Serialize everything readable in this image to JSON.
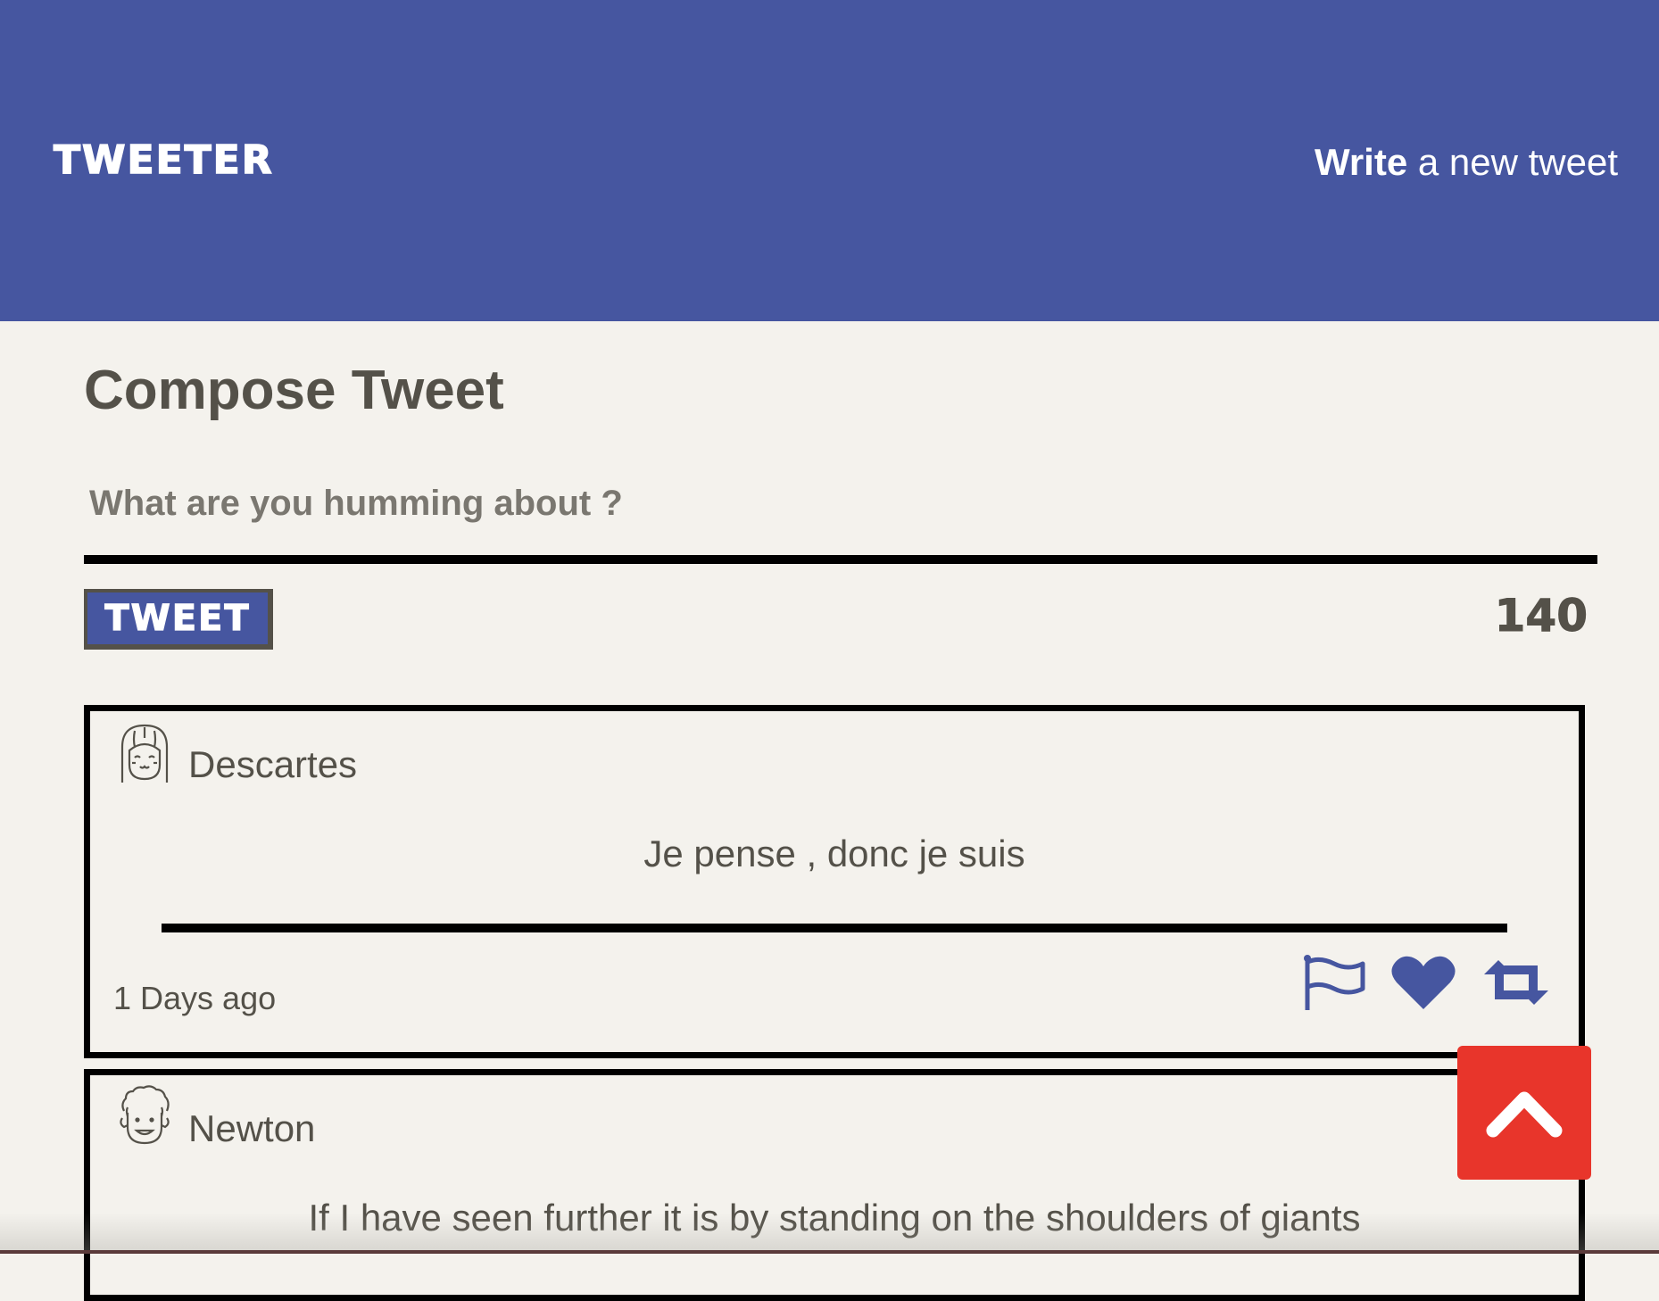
{
  "nav": {
    "brand": "TWEETER",
    "compose_bold": "Write",
    "compose_rest": " a new tweet"
  },
  "compose": {
    "title": "Compose Tweet",
    "placeholder": "What are you humming about ?",
    "button_label": "TWEET",
    "counter": "140"
  },
  "tweets": [
    {
      "author": "Descartes",
      "avatar_icon": "girl-avatar-icon",
      "content": "Je pense , donc je suis",
      "timestamp": "1 Days ago",
      "actions": [
        "flag-icon",
        "heart-icon",
        "retweet-icon"
      ]
    },
    {
      "author": "Newton",
      "avatar_icon": "curly-hair-avatar-icon",
      "content": "If I have seen further it is by standing on the shoulders of giants"
    }
  ],
  "colors": {
    "navbar": "#4656a0",
    "background": "#f4f2ed",
    "text": "#545149",
    "scroll_top_button": "#e8352b"
  },
  "scroll_top_icon": "chevron-up-icon"
}
